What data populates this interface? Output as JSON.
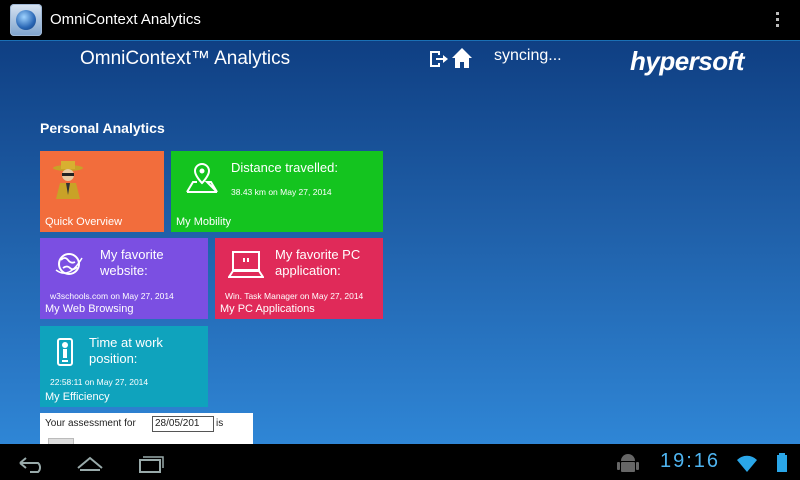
{
  "action_bar": {
    "title": "OmniContext Analytics",
    "app_icon": "globe-app-icon",
    "overflow_icon": "vertical-dots-icon"
  },
  "header": {
    "title": "OmniContext™ Analytics",
    "sync_status": "syncing...",
    "brand": "hypersoft",
    "icons": [
      "logout-icon",
      "home-icon"
    ]
  },
  "section": {
    "title": "Personal Analytics"
  },
  "tiles": [
    {
      "name": "Quick Overview",
      "heading": "",
      "detail": "",
      "color": "#f26d3c",
      "icon": "detective-icon"
    },
    {
      "name": "My Mobility",
      "heading": "Distance travelled:",
      "detail": "38.43 km on May 27, 2014",
      "color": "#14c41f",
      "icon": "map-pin-icon"
    },
    {
      "name": "My Web Browsing",
      "heading": "My favorite website:",
      "detail": "w3schools.com on May 27, 2014",
      "color": "#7b4fe2",
      "icon": "globe-icon"
    },
    {
      "name": "My PC Applications",
      "heading": "My favorite PC application:",
      "detail": "Win. Task Manager on May 27, 2014",
      "color": "#e02a59",
      "icon": "laptop-icon"
    },
    {
      "name": "My Efficiency",
      "heading": "Time at work position:",
      "detail": "22:58:11 on May 27, 2014",
      "color": "#0fa3bd",
      "icon": "worker-icon"
    }
  ],
  "assessment": {
    "label_prefix": "Your assessment for",
    "date_value": "28/05/201",
    "label_suffix": "is"
  },
  "status_bar": {
    "time": "19:16",
    "icons": [
      "android-debug-icon",
      "wifi-icon",
      "battery-icon"
    ]
  },
  "nav_bar": {
    "icons": [
      "back-icon",
      "home-nav-icon",
      "recent-apps-icon"
    ]
  }
}
